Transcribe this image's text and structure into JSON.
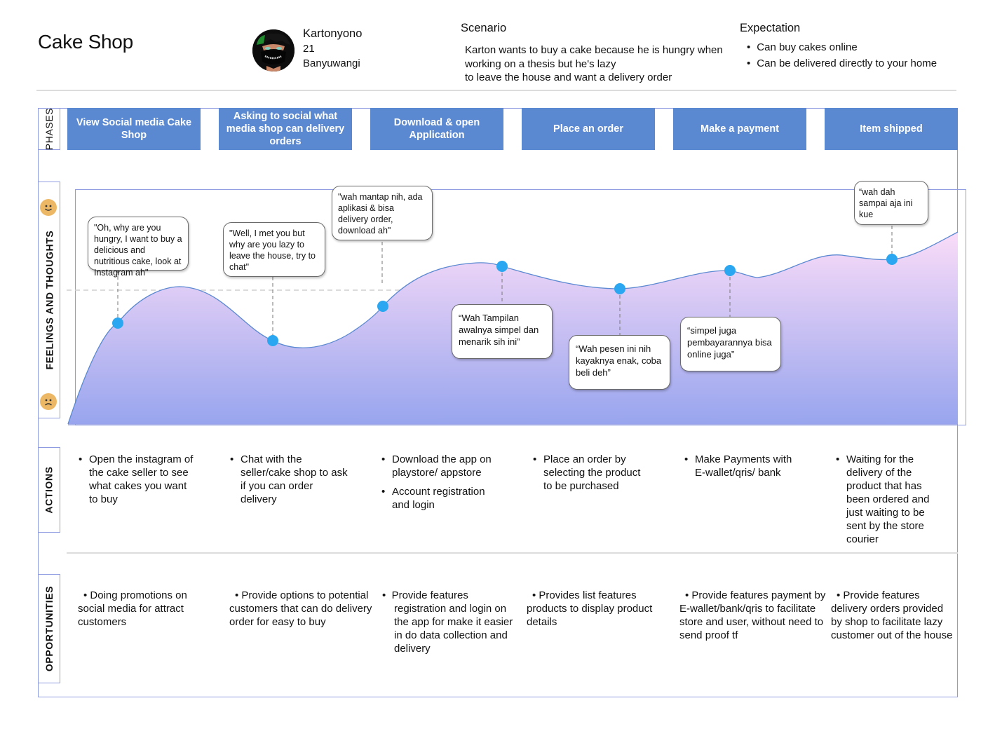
{
  "header": {
    "title": "Cake Shop",
    "persona": {
      "name": "Kartonyono",
      "age": "21",
      "city": "Banyuwangi",
      "avatar_icon": "persona-avatar"
    },
    "scenario": {
      "heading": "Scenario",
      "lines": [
        "Karton wants to buy a cake because he is hungry when",
        "working on a thesis but he's lazy",
        "to leave the house and want a delivery order"
      ]
    },
    "expectation": {
      "heading": "Expectation",
      "items": [
        "Can buy cakes online",
        "Can be delivered directly to your home"
      ]
    }
  },
  "rows": {
    "phases": "PHASES",
    "feelings": "FEELINGS AND THOUGHTS",
    "actions": "ACTIONS",
    "opportunities": "OPPORTUNITIES"
  },
  "phases": [
    "View Social media Cake Shop",
    "Asking to social what media shop can delivery orders",
    "Download & open Application",
    "Place an order",
    "Make a payment",
    "Item shipped"
  ],
  "feelings": {
    "icons": [
      "happy-face-icon",
      "sad-face-icon"
    ],
    "colors": {
      "curve_top": "#f7d9f7",
      "curve_bottom": "#98a6ee",
      "line": "#5b89d1",
      "point": "#2aa7f0",
      "emoji": "#edb866"
    },
    "sentiment_scale": "0 = sad, 1 = happy",
    "points": [
      {
        "phase": 1,
        "sentiment": 0.54,
        "quote": "\"Oh, why are you hungry, I want to buy a delicious and nutritious cake, look at Instagram ah\""
      },
      {
        "phase": 2,
        "sentiment": 0.38,
        "quote": "\"Well, I met you but why are you lazy to leave the house, try to chat\""
      },
      {
        "phase": 3,
        "sentiment": 0.61,
        "quote": "\"wah mantap nih, ada aplikasi & bisa delivery order, download ah\""
      },
      {
        "phase": 4,
        "sentiment": 0.82,
        "quote": "“Wah Tampilan awalnya simpel dan menarik sih ini”"
      },
      {
        "phase": 5,
        "sentiment": 0.73,
        "quote": "“Wah pesen ini nih kayaknya enak, coba beli deh”"
      },
      {
        "phase": 6,
        "sentiment": 0.8,
        "quote": "“simpel juga pembayarannya bisa online juga”"
      },
      {
        "phase": 7,
        "sentiment": 0.85,
        "quote": "“wah dah sampai aja ini kue"
      }
    ]
  },
  "actions": [
    [
      "Open the instagram of the cake seller to see what cakes you want to buy"
    ],
    [
      "Chat with the seller/cake shop to ask if you can order delivery"
    ],
    [
      "Download the app on playstore/ appstore",
      "Account registration and login"
    ],
    [
      "Place an order by selecting the product to be purchased"
    ],
    [
      "Make Payments with E-wallet/qris/ bank"
    ],
    [
      "Waiting for the delivery of the product that has been ordered and just waiting to be sent by the store courier"
    ]
  ],
  "opportunities": [
    "Doing promotions on social media for attract customers",
    "Provide options to potential customers that can do delivery order for easy to buy",
    "Provide features registration and login on the app for make it easier in do data collection and delivery",
    "Provides list features products to display product details",
    "Provide features payment by E-wallet/bank/qris to facilitate store and user, without need to send proof tf",
    "Provide features delivery orders provided by shop to facilitate lazy customer out of the house"
  ]
}
